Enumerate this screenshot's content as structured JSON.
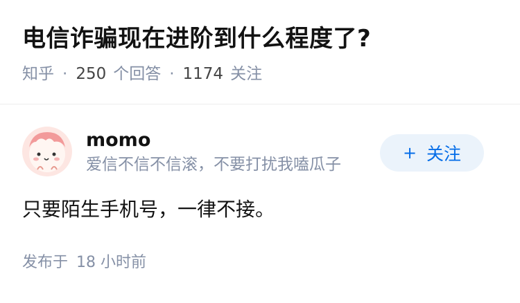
{
  "question": {
    "title": "电信诈骗现在进阶到什么程度了?",
    "source": "知乎",
    "separator": "·",
    "answer_count": "250",
    "answer_label": "个回答",
    "follow_count": "1174",
    "follow_label": "关注"
  },
  "answer": {
    "author_name": "momo",
    "author_bio": "爱信不信不信滚，不要打扰我嗑瓜子",
    "follow_button": "关注",
    "follow_icon": "plus-icon",
    "content": "只要陌生手机号，一律不接。",
    "published_prefix": "发布于",
    "published_time": "18 小时前"
  },
  "colors": {
    "accent": "#056de8",
    "follow_bg": "#ebf3fb",
    "meta": "#8590a6"
  }
}
